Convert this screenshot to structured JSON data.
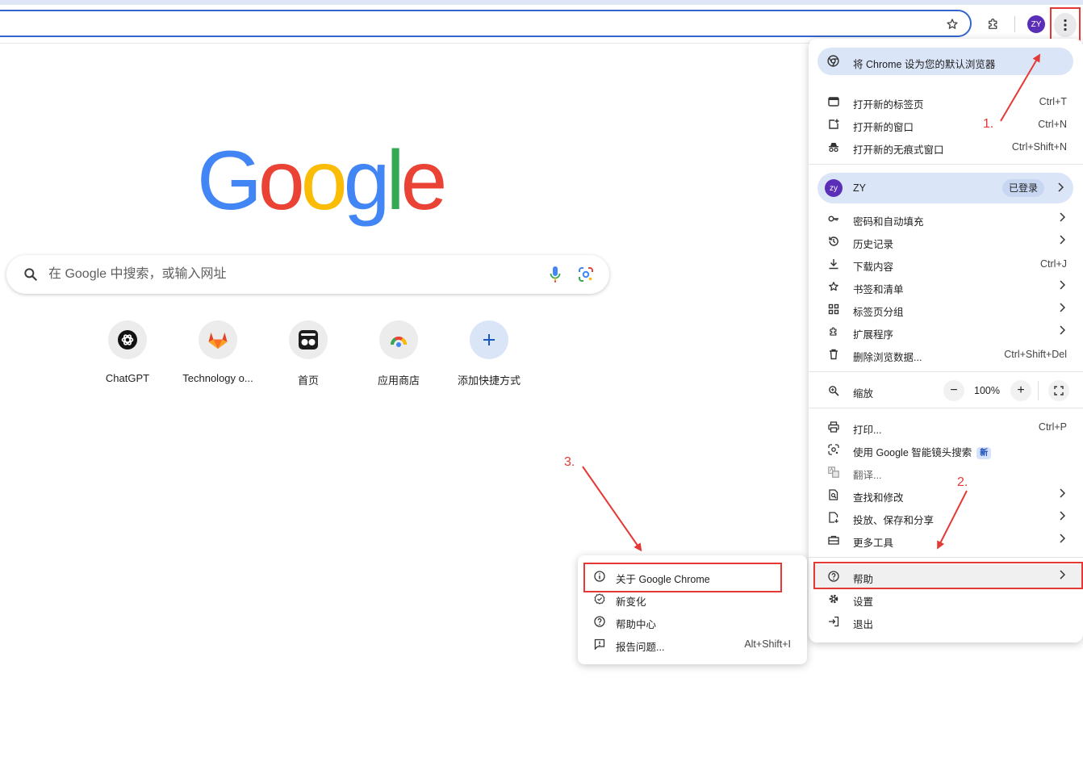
{
  "toolbar": {
    "avatar_initials": "ZY",
    "icons": [
      "star-icon",
      "extensions-icon",
      "more-vert-icon"
    ]
  },
  "ntp": {
    "logo_letters": [
      {
        "ch": "G",
        "color": "#4285f4"
      },
      {
        "ch": "o",
        "color": "#ea4335"
      },
      {
        "ch": "o",
        "color": "#fbbc05"
      },
      {
        "ch": "g",
        "color": "#4285f4"
      },
      {
        "ch": "l",
        "color": "#34a853"
      },
      {
        "ch": "e",
        "color": "#ea4335"
      }
    ],
    "search_placeholder": "在 Google 中搜索，或输入网址",
    "shortcuts": [
      {
        "label": "ChatGPT",
        "icon": "chatgpt-icon"
      },
      {
        "label": "Technology o...",
        "icon": "gitlab-icon"
      },
      {
        "label": "首页",
        "icon": "home-app-icon"
      },
      {
        "label": "应用商店",
        "icon": "webstore-icon"
      },
      {
        "label": "添加快捷方式",
        "icon": "plus-icon"
      }
    ]
  },
  "menu": {
    "default_banner": "将 Chrome 设为您的默认浏览器",
    "new_tab": {
      "label": "打开新的标签页",
      "shortcut": "Ctrl+T"
    },
    "new_window": {
      "label": "打开新的窗口",
      "shortcut": "Ctrl+N"
    },
    "incognito": {
      "label": "打开新的无痕式窗口",
      "shortcut": "Ctrl+Shift+N"
    },
    "profile": {
      "initials": "zy",
      "name": "ZY",
      "status": "已登录"
    },
    "passwords": {
      "label": "密码和自动填充"
    },
    "history": {
      "label": "历史记录"
    },
    "downloads": {
      "label": "下载内容",
      "shortcut": "Ctrl+J"
    },
    "bookmarks": {
      "label": "书签和清单"
    },
    "tab_groups": {
      "label": "标签页分组"
    },
    "extensions": {
      "label": "扩展程序"
    },
    "clear_data": {
      "label": "删除浏览数据...",
      "shortcut": "Ctrl+Shift+Del"
    },
    "zoom": {
      "label": "缩放",
      "value": "100%",
      "minus": "−",
      "plus": "+"
    },
    "print": {
      "label": "打印...",
      "shortcut": "Ctrl+P"
    },
    "lens": {
      "label": "使用 Google 智能镜头搜索",
      "badge": "新"
    },
    "translate": {
      "label": "翻译..."
    },
    "find_edit": {
      "label": "查找和修改"
    },
    "cast_save": {
      "label": "投放、保存和分享"
    },
    "more_tools": {
      "label": "更多工具"
    },
    "help": {
      "label": "帮助"
    },
    "settings": {
      "label": "设置"
    },
    "exit": {
      "label": "退出"
    }
  },
  "submenu": {
    "about": {
      "label": "关于 Google Chrome"
    },
    "whats_new": {
      "label": "新变化"
    },
    "help_center": {
      "label": "帮助中心"
    },
    "report": {
      "label": "报告问题...",
      "shortcut": "Alt+Shift+I"
    }
  },
  "annotations": {
    "step1": "1.",
    "step2": "2.",
    "step3": "3.",
    "color": "#e53935"
  }
}
